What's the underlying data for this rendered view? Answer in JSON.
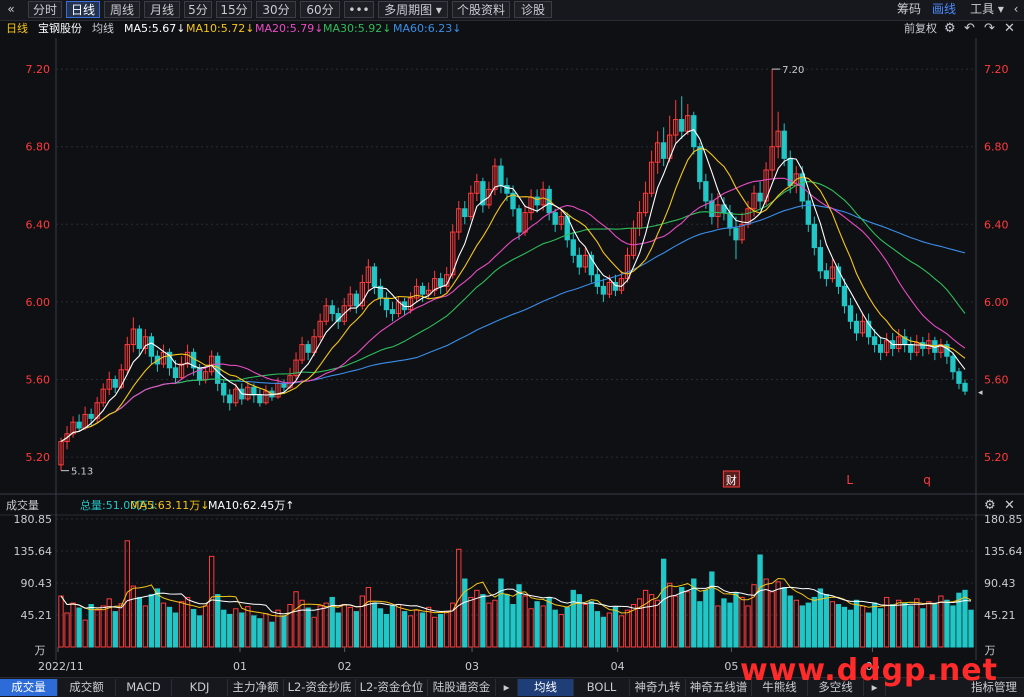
{
  "toolbar": {
    "back_icon": "«",
    "tabs": [
      {
        "label": "分时"
      },
      {
        "label": "日线"
      },
      {
        "label": "周线"
      },
      {
        "label": "月线"
      },
      {
        "label": "5分"
      },
      {
        "label": "15分"
      },
      {
        "label": "30分"
      },
      {
        "label": "60分"
      },
      {
        "label": "•••"
      },
      {
        "label": "多周期图 ▾"
      },
      {
        "label": "个股资料"
      },
      {
        "label": "诊股"
      }
    ],
    "right": [
      {
        "label": "筹码"
      },
      {
        "label": "画线"
      },
      {
        "label": "工具 ▾"
      }
    ]
  },
  "legend": {
    "period": "日线",
    "stock": "宝钢股份",
    "avg": "均线",
    "ma5": "MA5:5.67↓",
    "ma10": "MA10:5.72↓",
    "ma20": "MA20:5.79↓",
    "ma30": "MA30:5.92↓",
    "ma60": "MA60:6.23↓",
    "adjust": "前复权"
  },
  "volume_legend": {
    "title": "成交量",
    "total": "总量:51.00万↓",
    "ma5": "MA5:63.11万↓",
    "ma10": "MA10:62.45万↑"
  },
  "colors": {
    "up": "#ff3b3b",
    "down": "#21c6c6",
    "ma5": "#ffffff",
    "ma10": "#f5c518",
    "ma20": "#e94cc2",
    "ma30": "#2ebd5a",
    "ma60": "#3a8ee8",
    "bg": "#0f1014",
    "grid": "#2a2c33"
  },
  "chart_data": [
    {
      "type": "candlestick",
      "title": "宝钢股份 日线",
      "y_ticks": [
        7.2,
        6.8,
        6.4,
        6.0,
        5.6,
        5.2
      ],
      "ylim": [
        5.02,
        7.35
      ],
      "x_ticks": [
        "2022/11",
        "01",
        "02",
        "03",
        "04",
        "05",
        "06"
      ],
      "annotations": [
        {
          "label": "7.20"
        },
        {
          "label": "5.13"
        }
      ],
      "markers": [
        "财",
        "L",
        "q"
      ],
      "candles": [
        [
          5.16,
          5.28,
          5.13,
          5.3
        ],
        [
          5.28,
          5.32,
          5.24,
          5.36
        ],
        [
          5.32,
          5.38,
          5.3,
          5.41
        ],
        [
          5.38,
          5.35,
          5.33,
          5.42
        ],
        [
          5.35,
          5.42,
          5.34,
          5.46
        ],
        [
          5.42,
          5.4,
          5.36,
          5.45
        ],
        [
          5.4,
          5.48,
          5.38,
          5.51
        ],
        [
          5.48,
          5.55,
          5.46,
          5.58
        ],
        [
          5.55,
          5.6,
          5.52,
          5.64
        ],
        [
          5.6,
          5.56,
          5.53,
          5.62
        ],
        [
          5.56,
          5.65,
          5.55,
          5.68
        ],
        [
          5.65,
          5.78,
          5.63,
          5.82
        ],
        [
          5.78,
          5.86,
          5.74,
          5.92
        ],
        [
          5.86,
          5.76,
          5.72,
          5.88
        ],
        [
          5.76,
          5.82,
          5.73,
          5.86
        ],
        [
          5.82,
          5.72,
          5.68,
          5.84
        ],
        [
          5.72,
          5.68,
          5.64,
          5.75
        ],
        [
          5.68,
          5.74,
          5.66,
          5.78
        ],
        [
          5.74,
          5.66,
          5.62,
          5.76
        ],
        [
          5.66,
          5.61,
          5.58,
          5.7
        ],
        [
          5.61,
          5.68,
          5.6,
          5.72
        ],
        [
          5.68,
          5.74,
          5.66,
          5.78
        ],
        [
          5.74,
          5.66,
          5.62,
          5.76
        ],
        [
          5.66,
          5.6,
          5.57,
          5.68
        ],
        [
          5.6,
          5.64,
          5.58,
          5.67
        ],
        [
          5.64,
          5.72,
          5.62,
          5.75
        ],
        [
          5.72,
          5.58,
          5.54,
          5.74
        ],
        [
          5.58,
          5.52,
          5.48,
          5.6
        ],
        [
          5.52,
          5.48,
          5.44,
          5.55
        ],
        [
          5.48,
          5.55,
          5.46,
          5.58
        ],
        [
          5.55,
          5.5,
          5.47,
          5.58
        ],
        [
          5.5,
          5.56,
          5.49,
          5.59
        ],
        [
          5.56,
          5.52,
          5.48,
          5.58
        ],
        [
          5.52,
          5.48,
          5.46,
          5.55
        ],
        [
          5.48,
          5.54,
          5.47,
          5.57
        ],
        [
          5.54,
          5.51,
          5.49,
          5.56
        ],
        [
          5.51,
          5.58,
          5.5,
          5.61
        ],
        [
          5.58,
          5.56,
          5.53,
          5.6
        ],
        [
          5.56,
          5.62,
          5.55,
          5.66
        ],
        [
          5.62,
          5.7,
          5.6,
          5.74
        ],
        [
          5.7,
          5.78,
          5.68,
          5.82
        ],
        [
          5.78,
          5.74,
          5.7,
          5.8
        ],
        [
          5.74,
          5.82,
          5.72,
          5.86
        ],
        [
          5.82,
          5.9,
          5.8,
          5.94
        ],
        [
          5.9,
          5.98,
          5.88,
          6.02
        ],
        [
          5.98,
          5.94,
          5.9,
          6.01
        ],
        [
          5.94,
          5.9,
          5.86,
          5.97
        ],
        [
          5.9,
          5.98,
          5.88,
          6.02
        ],
        [
          5.98,
          6.04,
          5.95,
          6.08
        ],
        [
          6.04,
          5.98,
          5.94,
          6.06
        ],
        [
          5.98,
          6.1,
          5.96,
          6.14
        ],
        [
          6.1,
          6.18,
          6.06,
          6.22
        ],
        [
          6.18,
          6.08,
          6.04,
          6.2
        ],
        [
          6.08,
          6.02,
          5.98,
          6.12
        ],
        [
          6.02,
          5.96,
          5.92,
          6.05
        ],
        [
          5.96,
          5.94,
          5.9,
          6.0
        ],
        [
          5.94,
          6.0,
          5.92,
          6.03
        ],
        [
          6.0,
          5.96,
          5.93,
          6.02
        ],
        [
          5.96,
          6.02,
          5.94,
          6.05
        ],
        [
          6.02,
          6.08,
          6.0,
          6.12
        ],
        [
          6.08,
          6.04,
          6.0,
          6.1
        ],
        [
          6.04,
          6.06,
          6.02,
          6.1
        ],
        [
          6.06,
          6.12,
          6.03,
          6.16
        ],
        [
          6.12,
          6.08,
          6.04,
          6.15
        ],
        [
          6.08,
          6.14,
          6.05,
          6.18
        ],
        [
          6.14,
          6.36,
          6.12,
          6.4
        ],
        [
          6.36,
          6.48,
          6.32,
          6.52
        ],
        [
          6.48,
          6.44,
          6.4,
          6.52
        ],
        [
          6.44,
          6.56,
          6.42,
          6.6
        ],
        [
          6.56,
          6.62,
          6.52,
          6.66
        ],
        [
          6.62,
          6.5,
          6.46,
          6.64
        ],
        [
          6.5,
          6.58,
          6.48,
          6.62
        ],
        [
          6.58,
          6.7,
          6.55,
          6.74
        ],
        [
          6.7,
          6.6,
          6.56,
          6.74
        ],
        [
          6.6,
          6.56,
          6.52,
          6.64
        ],
        [
          6.56,
          6.48,
          6.44,
          6.6
        ],
        [
          6.48,
          6.36,
          6.32,
          6.5
        ],
        [
          6.36,
          6.46,
          6.34,
          6.5
        ],
        [
          6.46,
          6.54,
          6.42,
          6.58
        ],
        [
          6.54,
          6.5,
          6.46,
          6.58
        ],
        [
          6.5,
          6.58,
          6.47,
          6.62
        ],
        [
          6.58,
          6.46,
          6.42,
          6.6
        ],
        [
          6.46,
          6.4,
          6.36,
          6.48
        ],
        [
          6.4,
          6.44,
          6.37,
          6.48
        ],
        [
          6.44,
          6.32,
          6.28,
          6.46
        ],
        [
          6.32,
          6.24,
          6.2,
          6.36
        ],
        [
          6.24,
          6.18,
          6.14,
          6.28
        ],
        [
          6.18,
          6.24,
          6.15,
          6.28
        ],
        [
          6.24,
          6.14,
          6.1,
          6.26
        ],
        [
          6.14,
          6.08,
          6.04,
          6.18
        ],
        [
          6.08,
          6.04,
          6.0,
          6.12
        ],
        [
          6.04,
          6.1,
          6.02,
          6.14
        ],
        [
          6.1,
          6.06,
          6.03,
          6.14
        ],
        [
          6.06,
          6.12,
          6.04,
          6.16
        ],
        [
          6.12,
          6.24,
          6.1,
          6.28
        ],
        [
          6.24,
          6.38,
          6.22,
          6.42
        ],
        [
          6.38,
          6.46,
          6.34,
          6.52
        ],
        [
          6.46,
          6.56,
          6.44,
          6.62
        ],
        [
          6.56,
          6.72,
          6.54,
          6.78
        ],
        [
          6.72,
          6.82,
          6.66,
          6.88
        ],
        [
          6.82,
          6.74,
          6.7,
          6.9
        ],
        [
          6.74,
          6.86,
          6.72,
          6.96
        ],
        [
          6.86,
          6.94,
          6.82,
          7.04
        ],
        [
          6.94,
          6.88,
          6.84,
          7.06
        ],
        [
          6.88,
          6.96,
          6.86,
          7.02
        ],
        [
          6.96,
          6.8,
          6.76,
          6.98
        ],
        [
          6.8,
          6.62,
          6.58,
          6.82
        ],
        [
          6.62,
          6.52,
          6.48,
          6.66
        ],
        [
          6.52,
          6.44,
          6.4,
          6.56
        ],
        [
          6.44,
          6.5,
          6.38,
          6.56
        ],
        [
          6.5,
          6.46,
          6.42,
          6.54
        ],
        [
          6.46,
          6.38,
          6.34,
          6.5
        ],
        [
          6.38,
          6.32,
          6.22,
          6.44
        ],
        [
          6.32,
          6.4,
          6.3,
          6.46
        ],
        [
          6.4,
          6.48,
          6.38,
          6.52
        ],
        [
          6.48,
          6.56,
          6.44,
          6.6
        ],
        [
          6.56,
          6.52,
          6.48,
          6.62
        ],
        [
          6.52,
          6.68,
          6.5,
          6.72
        ],
        [
          6.68,
          6.8,
          6.64,
          7.2
        ],
        [
          6.8,
          6.88,
          6.74,
          6.98
        ],
        [
          6.88,
          6.74,
          6.7,
          6.92
        ],
        [
          6.74,
          6.6,
          6.56,
          6.78
        ],
        [
          6.6,
          6.66,
          6.56,
          6.7
        ],
        [
          6.66,
          6.52,
          6.48,
          6.7
        ],
        [
          6.52,
          6.4,
          6.36,
          6.56
        ],
        [
          6.4,
          6.28,
          6.24,
          6.44
        ],
        [
          6.28,
          6.16,
          6.12,
          6.32
        ],
        [
          6.16,
          6.12,
          6.08,
          6.2
        ],
        [
          6.12,
          6.18,
          6.1,
          6.22
        ],
        [
          6.18,
          6.08,
          6.04,
          6.2
        ],
        [
          6.08,
          5.98,
          5.94,
          6.12
        ],
        [
          5.98,
          5.9,
          5.86,
          6.02
        ],
        [
          5.9,
          5.84,
          5.8,
          5.94
        ],
        [
          5.84,
          5.9,
          5.82,
          5.94
        ],
        [
          5.9,
          5.82,
          5.78,
          5.94
        ],
        [
          5.82,
          5.78,
          5.74,
          5.86
        ],
        [
          5.78,
          5.74,
          5.7,
          5.82
        ],
        [
          5.74,
          5.8,
          5.72,
          5.84
        ],
        [
          5.8,
          5.76,
          5.72,
          5.84
        ],
        [
          5.76,
          5.82,
          5.74,
          5.86
        ],
        [
          5.82,
          5.78,
          5.74,
          5.86
        ],
        [
          5.78,
          5.74,
          5.7,
          5.82
        ],
        [
          5.74,
          5.79,
          5.72,
          5.83
        ],
        [
          5.79,
          5.76,
          5.72,
          5.82
        ],
        [
          5.76,
          5.8,
          5.73,
          5.84
        ],
        [
          5.8,
          5.74,
          5.7,
          5.82
        ],
        [
          5.74,
          5.78,
          5.71,
          5.81
        ],
        [
          5.78,
          5.72,
          5.68,
          5.8
        ],
        [
          5.72,
          5.64,
          5.6,
          5.74
        ],
        [
          5.64,
          5.58,
          5.55,
          5.66
        ],
        [
          5.58,
          5.54,
          5.52,
          5.6
        ]
      ],
      "ma_labels": [
        "MA5",
        "MA10",
        "MA20",
        "MA30",
        "MA60"
      ]
    },
    {
      "type": "bar",
      "title": "成交量",
      "y_ticks": [
        180.85,
        135.64,
        90.43,
        45.21
      ],
      "y_unit": "万",
      "ylim": [
        0,
        185
      ],
      "values": [
        72,
        48,
        62,
        55,
        38,
        60,
        52,
        58,
        68,
        50,
        61,
        150,
        86,
        70,
        58,
        74,
        82,
        62,
        56,
        48,
        64,
        70,
        53,
        44,
        58,
        128,
        74,
        52,
        46,
        54,
        48,
        57,
        44,
        40,
        47,
        35,
        52,
        44,
        60,
        78,
        66,
        55,
        42,
        58,
        62,
        70,
        48,
        60,
        56,
        50,
        72,
        84,
        62,
        54,
        46,
        58,
        60,
        50,
        44,
        52,
        48,
        56,
        42,
        46,
        50,
        62,
        138,
        96,
        70,
        80,
        74,
        62,
        66,
        96,
        74,
        60,
        88,
        72,
        54,
        64,
        58,
        70,
        52,
        46,
        56,
        80,
        74,
        60,
        64,
        50,
        42,
        48,
        56,
        44,
        52,
        60,
        68,
        80,
        74,
        66,
        124,
        90,
        72,
        84,
        78,
        96,
        64,
        80,
        106,
        58,
        68,
        62,
        76,
        70,
        58,
        88,
        130,
        96,
        78,
        92,
        84,
        72,
        66,
        58,
        62,
        70,
        82,
        74,
        64,
        60,
        56,
        52,
        66,
        58,
        48,
        62,
        54,
        70,
        60,
        66,
        62,
        58,
        68,
        54,
        64,
        60,
        72,
        66,
        58,
        76,
        80,
        52
      ],
      "ma_labels": [
        "MA5",
        "MA10"
      ]
    }
  ],
  "bottom_tabs": [
    "成交量",
    "成交额",
    "MACD",
    "KDJ",
    "主力净额",
    "L2-资金抄底",
    "L2-资金仓位",
    "陆股通资金",
    "▸",
    "均线",
    "BOLL",
    "神奇九转",
    "神奇五线谱",
    "牛熊线",
    "多空线",
    "▸",
    "指标管理"
  ],
  "watermark": "www.ddgp.net"
}
